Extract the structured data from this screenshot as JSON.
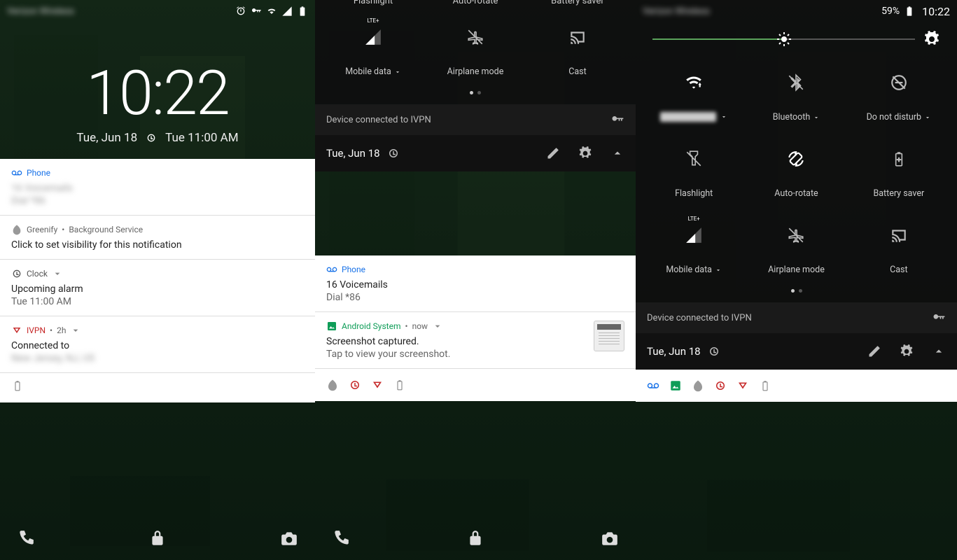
{
  "carrier_blur": "Verizon Wireless",
  "status": {
    "battery_pct": "59%",
    "time": "10:22"
  },
  "lockscreen": {
    "time": "10:22",
    "date": "Tue, Jun 18",
    "alarm": "Tue 11:00 AM"
  },
  "notifs": {
    "phone": {
      "app": "Phone",
      "title": "16 Voicemails",
      "body": "Dial *86",
      "color": "#1a73e8"
    },
    "greenify": {
      "app": "Greenify",
      "meta": "Background Service",
      "body": "Click to set visibility for this notification",
      "color": "#888"
    },
    "clock": {
      "app": "Clock",
      "title": "Upcoming alarm",
      "body": "Tue 11:00 AM",
      "color": "#555"
    },
    "ivpn": {
      "app": "IVPN",
      "meta": "2h",
      "title": "Connected to",
      "color": "#c62828"
    },
    "android_system": {
      "app": "Android System",
      "meta": "now",
      "title": "Screenshot captured.",
      "body": "Tap to view your screenshot.",
      "color": "#0f9d58"
    }
  },
  "qs": {
    "mobile_data": "Mobile data",
    "airplane": "Airplane mode",
    "cast": "Cast",
    "bluetooth": "Bluetooth",
    "dnd": "Do not disturb",
    "flashlight": "Flashlight",
    "auto_rotate": "Auto-rotate",
    "battery_saver": "Battery saver",
    "lte_badge": "LTE+"
  },
  "vpn_row": "Device connected to IVPN",
  "footer_date": "Tue, Jun 18",
  "brightness_pct": 50
}
